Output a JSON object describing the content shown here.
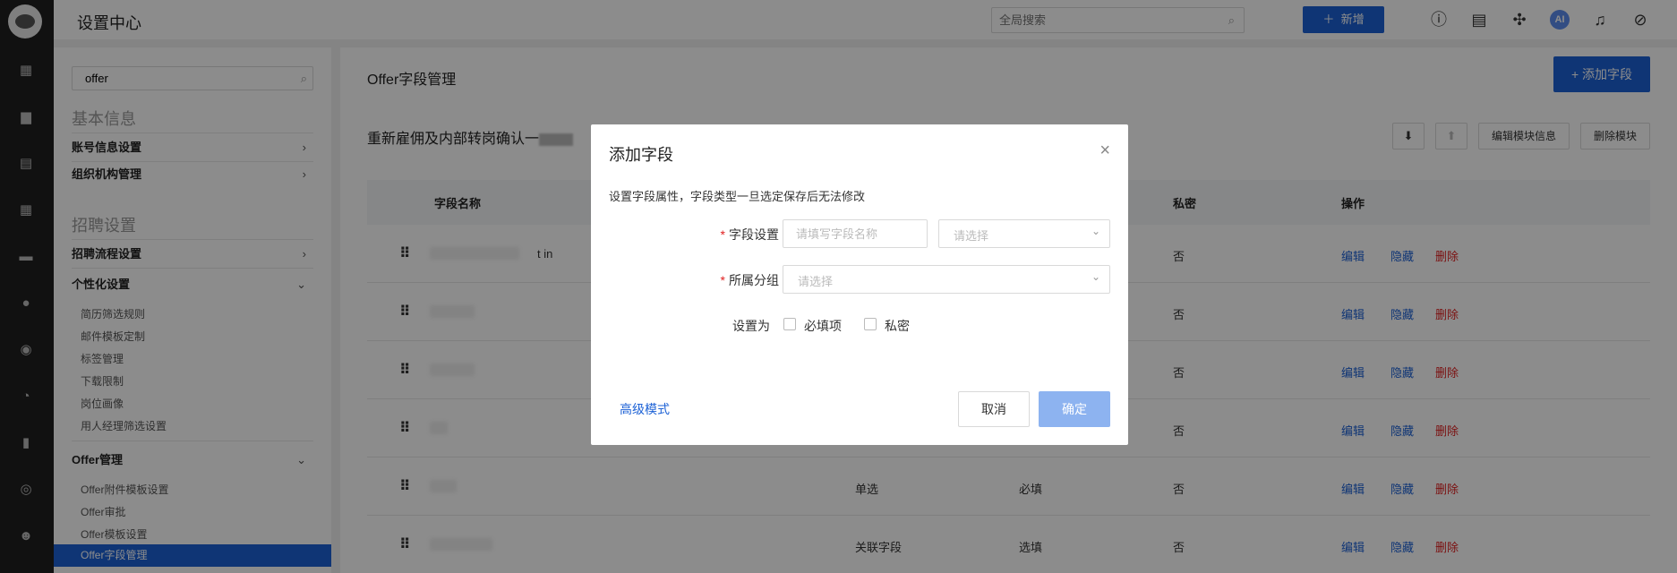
{
  "rail": {
    "icons": [
      "dashboard-icon",
      "briefcase-icon",
      "resume-icon",
      "calendar-icon",
      "id-card-icon",
      "wechat-icon",
      "like-icon",
      "pie-chart-icon",
      "bar-chart-icon",
      "user-circle-icon",
      "team-icon"
    ]
  },
  "topbar": {
    "title": "设置中心",
    "search_placeholder": "全局搜索",
    "new_button": "新增",
    "ai_label": "AI"
  },
  "sidebar": {
    "search_value": "offer",
    "sections": [
      {
        "title": "基本信息",
        "items": [
          {
            "label": "账号信息设置",
            "expanded": false
          },
          {
            "label": "组织机构管理",
            "expanded": false
          }
        ]
      },
      {
        "title": "招聘设置",
        "items": [
          {
            "label": "招聘流程设置",
            "expanded": false
          },
          {
            "label": "个性化设置",
            "expanded": true,
            "children": [
              "简历筛选规则",
              "邮件模板定制",
              "标签管理",
              "下载限制",
              "岗位画像",
              "用人经理筛选设置"
            ]
          },
          {
            "label": "Offer管理",
            "expanded": true,
            "children": [
              "Offer附件模板设置",
              "Offer审批",
              "Offer模板设置",
              "Offer字段管理"
            ]
          }
        ]
      }
    ],
    "active_item": "Offer字段管理"
  },
  "main": {
    "page_title": "Offer字段管理",
    "add_field_button": "+ 添加字段",
    "module_title": "重新雇佣及内部转岗确认一",
    "edit_module_button": "编辑模块信息",
    "delete_module_button": "删除模块",
    "table": {
      "headers": [
        "字段名称",
        "私密",
        "操作"
      ],
      "rows": [
        {
          "name_suffix": "t in",
          "type": "",
          "required": "",
          "private": "否"
        },
        {
          "name_suffix": "",
          "type": "",
          "required": "",
          "private": "否"
        },
        {
          "name_suffix": "",
          "type": "",
          "required": "",
          "private": "否"
        },
        {
          "name_suffix": "",
          "type": "",
          "required": "",
          "private": "否"
        },
        {
          "name_suffix": "",
          "type": "单选",
          "required": "必填",
          "private": "否"
        },
        {
          "name_suffix": "",
          "type": "关联字段",
          "required": "选填",
          "private": "否"
        }
      ],
      "actions": {
        "edit": "编辑",
        "hide": "隐藏",
        "delete": "删除"
      }
    }
  },
  "modal": {
    "title": "添加字段",
    "description": "设置字段属性，字段类型一旦选定保存后无法修改",
    "field_setting_label": "字段设置",
    "field_name_placeholder": "请填写字段名称",
    "field_type_placeholder": "请选择",
    "group_label": "所属分组",
    "group_placeholder": "请选择",
    "set_as_label": "设置为",
    "required_checkbox": "必填项",
    "private_checkbox": "私密",
    "advanced_mode": "高级模式",
    "cancel_button": "取消",
    "confirm_button": "确定"
  },
  "colors": {
    "primary": "#1d62d6",
    "danger": "#e02020",
    "rail_bg": "#1f1f1f",
    "confirm_disabled": "#8db3f0"
  }
}
